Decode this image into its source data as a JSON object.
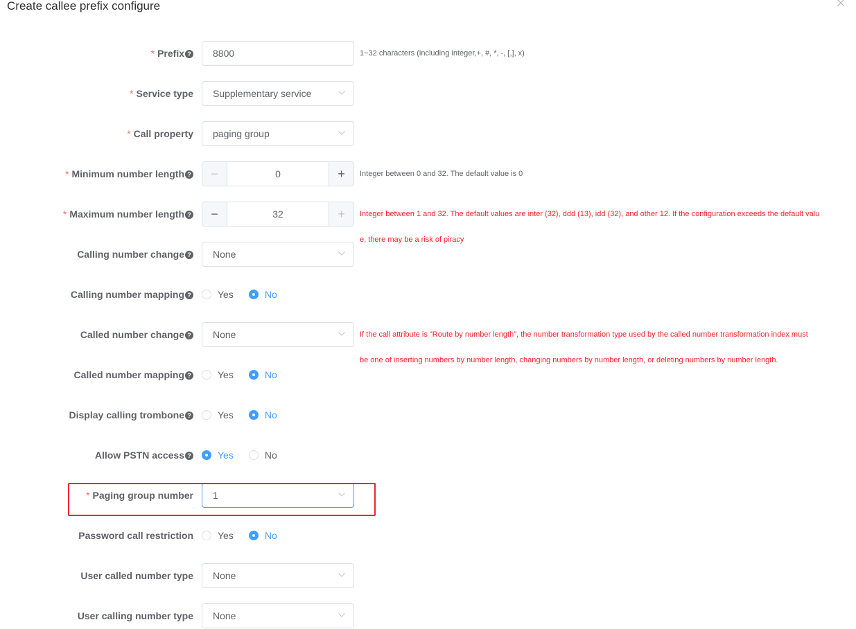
{
  "dialog": {
    "title": "Create callee prefix configure",
    "close_icon": "close-icon"
  },
  "colors": {
    "accent": "#409eff",
    "required": "#f56c6c",
    "error_text": "#f5222d",
    "highlight": "#f5222d"
  },
  "form": {
    "prefix": {
      "label": "Prefix",
      "required": "*",
      "help": "?",
      "value": "8800",
      "hint": "1~32 characters (including integer,+, #, *, -, [,], x)"
    },
    "service_type": {
      "label": "Service type",
      "required": "*",
      "value": "Supplementary service"
    },
    "call_property": {
      "label": "Call property",
      "required": "*",
      "value": "paging group"
    },
    "min_length": {
      "label": "Minimum number length",
      "required": "*",
      "help": "?",
      "value": "0",
      "dec": "−",
      "inc": "+",
      "hint": "Integer between 0 and 32. The default value is 0"
    },
    "max_length": {
      "label": "Maximum number length",
      "required": "*",
      "help": "?",
      "value": "32",
      "dec": "−",
      "inc": "+",
      "hint_line1": "Integer between 1 and 32. The default values are inter (32), ddd (13), idd (32), and other 12. If the configuration exceeds the default valu",
      "hint_line2": "e, there may be a risk of piracy"
    },
    "calling_number_change": {
      "label": "Calling number change",
      "help": "?",
      "value": "None"
    },
    "calling_number_mapping": {
      "label": "Calling number mapping",
      "help": "?",
      "options": [
        "Yes",
        "No"
      ],
      "selected": "No"
    },
    "called_number_change": {
      "label": "Called number change",
      "help": "?",
      "value": "None",
      "hint_line1": "If the call attribute is \"Route by number length\", the number transformation type used by the called number transformation index must",
      "hint_line2": "be one of inserting numbers by number length, changing numbers by number length, or deleting numbers by number length."
    },
    "called_number_mapping": {
      "label": "Called number mapping",
      "help": "?",
      "options": [
        "Yes",
        "No"
      ],
      "selected": "No"
    },
    "display_calling_trombone": {
      "label": "Display calling trombone",
      "help": "?",
      "options": [
        "Yes",
        "No"
      ],
      "selected": "No"
    },
    "allow_pstn_access": {
      "label": "Allow PSTN access",
      "help": "?",
      "options": [
        "Yes",
        "No"
      ],
      "selected": "Yes"
    },
    "paging_group_number": {
      "label": "Paging group number",
      "required": "*",
      "value": "1"
    },
    "password_call_restriction": {
      "label": "Password call restriction",
      "options": [
        "Yes",
        "No"
      ],
      "selected": "No"
    },
    "user_called_number_type": {
      "label": "User called number type",
      "value": "None"
    },
    "user_calling_number_type": {
      "label": "User calling number type",
      "value": "None"
    }
  }
}
